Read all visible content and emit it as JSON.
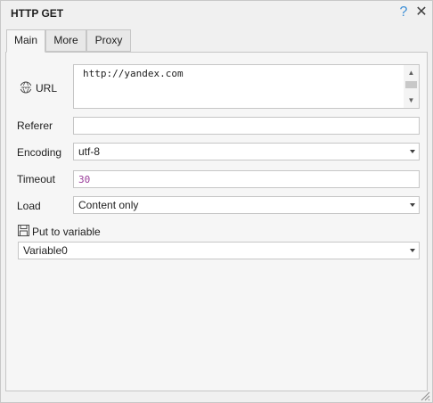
{
  "window": {
    "title": "HTTP GET",
    "help_label": "?",
    "close_label": "✕"
  },
  "tabs": [
    {
      "label": "Main",
      "active": true
    },
    {
      "label": "More",
      "active": false
    },
    {
      "label": "Proxy",
      "active": false
    }
  ],
  "form": {
    "url": {
      "label": "URL",
      "value": "http://yandex.com",
      "icon": "globe-icon"
    },
    "referer": {
      "label": "Referer",
      "value": ""
    },
    "encoding": {
      "label": "Encoding",
      "value": "utf-8"
    },
    "timeout": {
      "label": "Timeout",
      "value": "30"
    },
    "load": {
      "label": "Load",
      "value": "Content only"
    },
    "put_to_variable": {
      "label": "Put to variable",
      "value": "Variable0",
      "icon": "save-icon"
    }
  },
  "colors": {
    "accent": "#3d8fd6",
    "number_value": "#9a3c9a"
  }
}
